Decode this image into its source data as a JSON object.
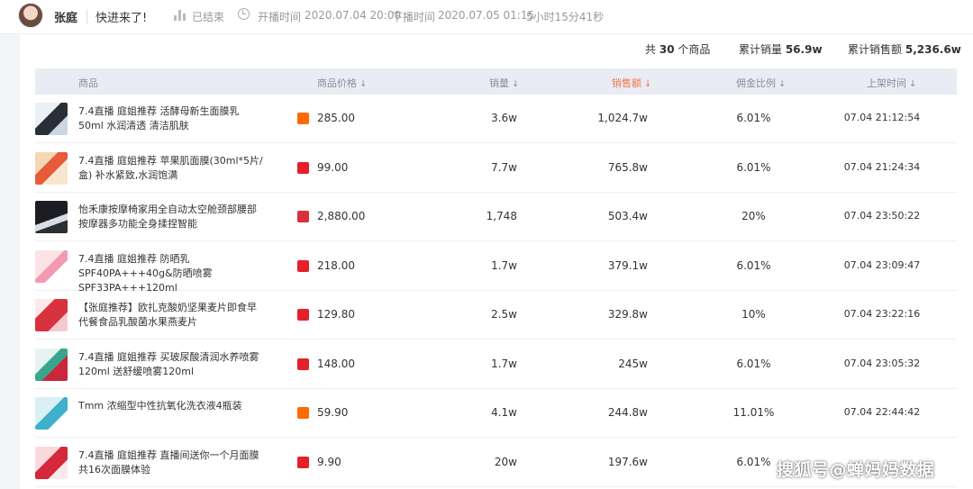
{
  "header": {
    "anchor_name": "张庭",
    "live_title": "快进来了!",
    "status": "已结束",
    "start_label": "开播时间",
    "start_time": "2020.07.04 20:00",
    "end_label": "下播时间",
    "end_time": "2020.07.05 01:15",
    "duration": "5小时15分41秒"
  },
  "summary": {
    "product_count_prefix": "共",
    "product_count": "30",
    "product_count_suffix": "个商品",
    "sales_label": "累计销量",
    "sales_value": "56.9w",
    "amount_label": "累计销售额",
    "amount_value": "5,236.6w"
  },
  "table": {
    "columns": {
      "product": "商品",
      "price": "商品价格",
      "sales": "销量",
      "amount": "销售额",
      "commission": "佣金比例",
      "time": "上架时间"
    },
    "sort_arrow": "↓",
    "rows": [
      {
        "name": "7.4直播 庭姐推荐 活酵母新生面膜乳50ml 水润清透 清洁肌肤",
        "platform": "taobao",
        "price": "285.00",
        "sales": "3.6w",
        "amount": "1,024.7w",
        "commission": "6.01%",
        "time": "07.04 21:12:54"
      },
      {
        "name": "7.4直播 庭姐推荐 苹果肌面膜(30ml*5片/盒) 补水紧致,水润饱满",
        "platform": "tmall",
        "price": "99.00",
        "sales": "7.7w",
        "amount": "765.8w",
        "commission": "6.01%",
        "time": "07.04 21:24:34"
      },
      {
        "name": "怡禾康按摩椅家用全自动太空舱颈部腰部按摩器多功能全身揉捏智能",
        "platform": "other",
        "price": "2,880.00",
        "sales": "1,748",
        "amount": "503.4w",
        "commission": "20%",
        "time": "07.04 23:50:22"
      },
      {
        "name": "7.4直播 庭姐推荐 防晒乳SPF40PA+++40g&防晒喷雾SPF33PA+++120ml",
        "platform": "tmall",
        "price": "218.00",
        "sales": "1.7w",
        "amount": "379.1w",
        "commission": "6.01%",
        "time": "07.04 23:09:47"
      },
      {
        "name": "【张庭推荐】欧扎克酸奶坚果麦片即食早代餐食品乳酸菌水果燕麦片",
        "platform": "tmall",
        "price": "129.80",
        "sales": "2.5w",
        "amount": "329.8w",
        "commission": "10%",
        "time": "07.04 23:22:16"
      },
      {
        "name": "7.4直播 庭姐推荐 买玻尿酸清润水养喷雾120ml 送舒缓喷雾120ml",
        "platform": "tmall",
        "price": "148.00",
        "sales": "1.7w",
        "amount": "245w",
        "commission": "6.01%",
        "time": "07.04 23:05:32"
      },
      {
        "name": "Tmm 浓缩型中性抗氧化洗衣液4瓶装",
        "platform": "taobao",
        "price": "59.90",
        "sales": "4.1w",
        "amount": "244.8w",
        "commission": "11.01%",
        "time": "07.04 22:44:42"
      },
      {
        "name": "7.4直播 庭姐推荐 直播间送你一个月面膜 共16次面膜体验",
        "platform": "tmall",
        "price": "9.90",
        "sales": "20w",
        "amount": "197.6w",
        "commission": "6.01%",
        "time": ""
      }
    ]
  },
  "watermark": "搜狐号@蝉妈妈数据",
  "colors": {
    "accent": "#f5764b",
    "header_bg": "#e9ecf3",
    "taobao": "#ff6a00",
    "tmall": "#e4202a",
    "other": "#d9303a"
  }
}
